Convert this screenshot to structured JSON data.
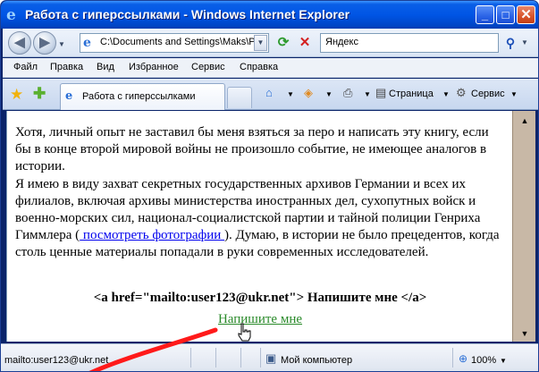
{
  "window": {
    "title": "Работа с гиперссылками - Windows Internet Explorer",
    "app_icon": "ie-logo-icon",
    "controls": {
      "minimize": "_",
      "maximize": "□",
      "close": "✕"
    }
  },
  "nav": {
    "back_glyph": "◀",
    "forward_glyph": "▶",
    "address": "C:\\Documents and Settings\\Maks\\P",
    "search_value": "Яндекс",
    "refresh_glyph": "⟳",
    "stop_glyph": "✕",
    "search_glyph": "⚲"
  },
  "menu": {
    "items": [
      "Файл",
      "Правка",
      "Вид",
      "Избранное",
      "Сервис",
      "Справка"
    ]
  },
  "tabs": {
    "active_label": "Работа с гиперссылками",
    "commands": {
      "page": "Страница",
      "tools": "Сервис"
    }
  },
  "page": {
    "p1": "Хотя, личный опыт не заставил бы меня взяться за перо и написать эту книгу, если бы в конце второй мировой войны не произошло событие, не имеющее аналогов в истории.",
    "p2_before": "Я имею в виду захват секретных государственных архивов Германии и всех их филиалов, включая архивы министерства иностранных дел, сухопутных войск и военно-морских сил, национал-социалистской партии и тайной полиции Генриха Гиммлера (",
    "p2_link": " посмотреть фотографии ",
    "p2_after": "). Думаю, в истории не было прецедентов, когда столь ценные материалы попадали в руки современных исследователей.",
    "code_line": "<a href=\"mailto:user123@ukr.net\"> Напишите мне </a>",
    "mail_link": "Напишите мне"
  },
  "status": {
    "text": "mailto:user123@ukr.net",
    "zone": "Мой компьютер",
    "zoom": "100%"
  },
  "colors": {
    "titlebar": "#0055e5",
    "link": "#0000ee",
    "mail_link": "#2a8a2a",
    "scrollbar": "#c8b8a6",
    "annotation_line": "#ff1a1a"
  }
}
